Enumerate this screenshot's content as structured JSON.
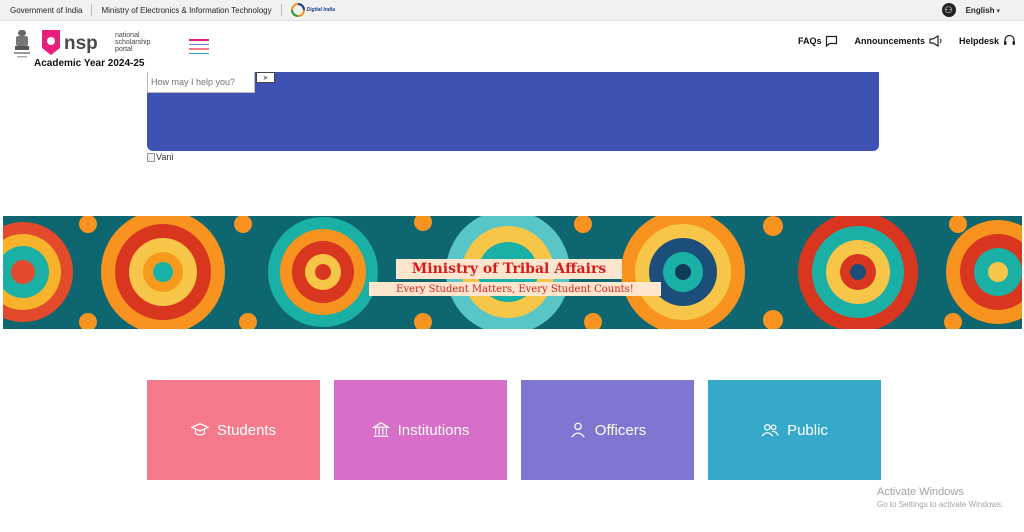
{
  "topbar": {
    "government": "Government of India",
    "ministry": "Ministry of Electronics & Information Technology",
    "digital_india": "Digital India",
    "language": "English"
  },
  "header": {
    "logo_letters": "nsp",
    "logo_text_1": "national",
    "logo_text_2": "scholarship",
    "logo_text_3": "portal",
    "academic_year": "Academic Year 2024-25",
    "nav": [
      {
        "label": "FAQs",
        "icon": "chat-bubble-icon"
      },
      {
        "label": "Announcements",
        "icon": "megaphone-icon"
      },
      {
        "label": "Helpdesk",
        "icon": "headset-icon"
      }
    ]
  },
  "chatbot": {
    "placeholder": "How may I help you?",
    "image_alt": "Vani",
    "panel_color": "#3e52b4"
  },
  "banner": {
    "title": "Ministry of Tribal Affairs",
    "subtitle": "Every Student Matters, Every Student Counts!"
  },
  "tiles": [
    {
      "label": "Students",
      "icon": "graduation-cap-icon",
      "color": "#f47a8c"
    },
    {
      "label": "Institutions",
      "icon": "institution-icon",
      "color": "#d76ec8"
    },
    {
      "label": "Officers",
      "icon": "user-icon",
      "color": "#7f76d2"
    },
    {
      "label": "Public",
      "icon": "users-icon",
      "color": "#36a8ca"
    }
  ],
  "watermark": {
    "line1": "Activate Windows",
    "line2": "Go to Settings to activate Windows."
  }
}
